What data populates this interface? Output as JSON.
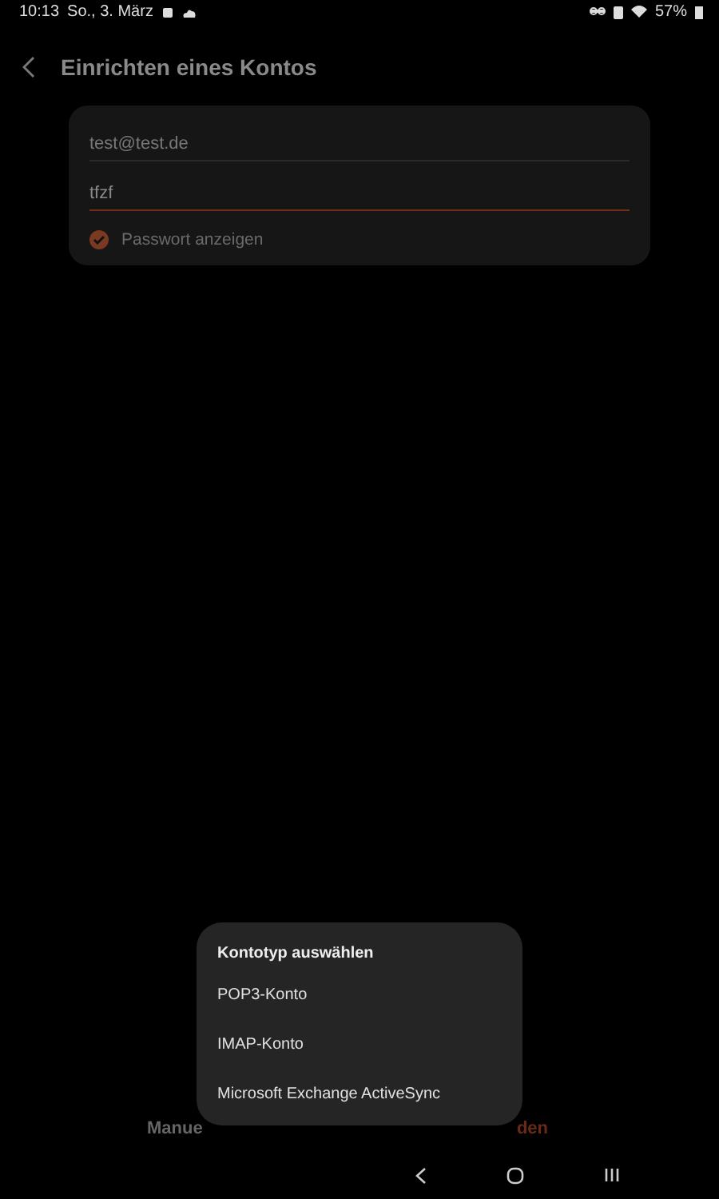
{
  "status_bar": {
    "time": "10:13",
    "date": "So., 3. März",
    "battery": "57%"
  },
  "header": {
    "title": "Einrichten eines Kontos"
  },
  "form": {
    "email": {
      "value": "test@test.de"
    },
    "password": {
      "value": "tfzf",
      "focused": true
    },
    "show_password": {
      "label": "Passwort anzeigen",
      "checked": true
    }
  },
  "bottom_buttons": [
    "Manue",
    "den"
  ],
  "dialog": {
    "title": "Kontotyp auswählen",
    "options": [
      {
        "label": "POP3-Konto"
      },
      {
        "label": "IMAP-Konto"
      },
      {
        "label": "Microsoft Exchange ActiveSync"
      }
    ]
  }
}
